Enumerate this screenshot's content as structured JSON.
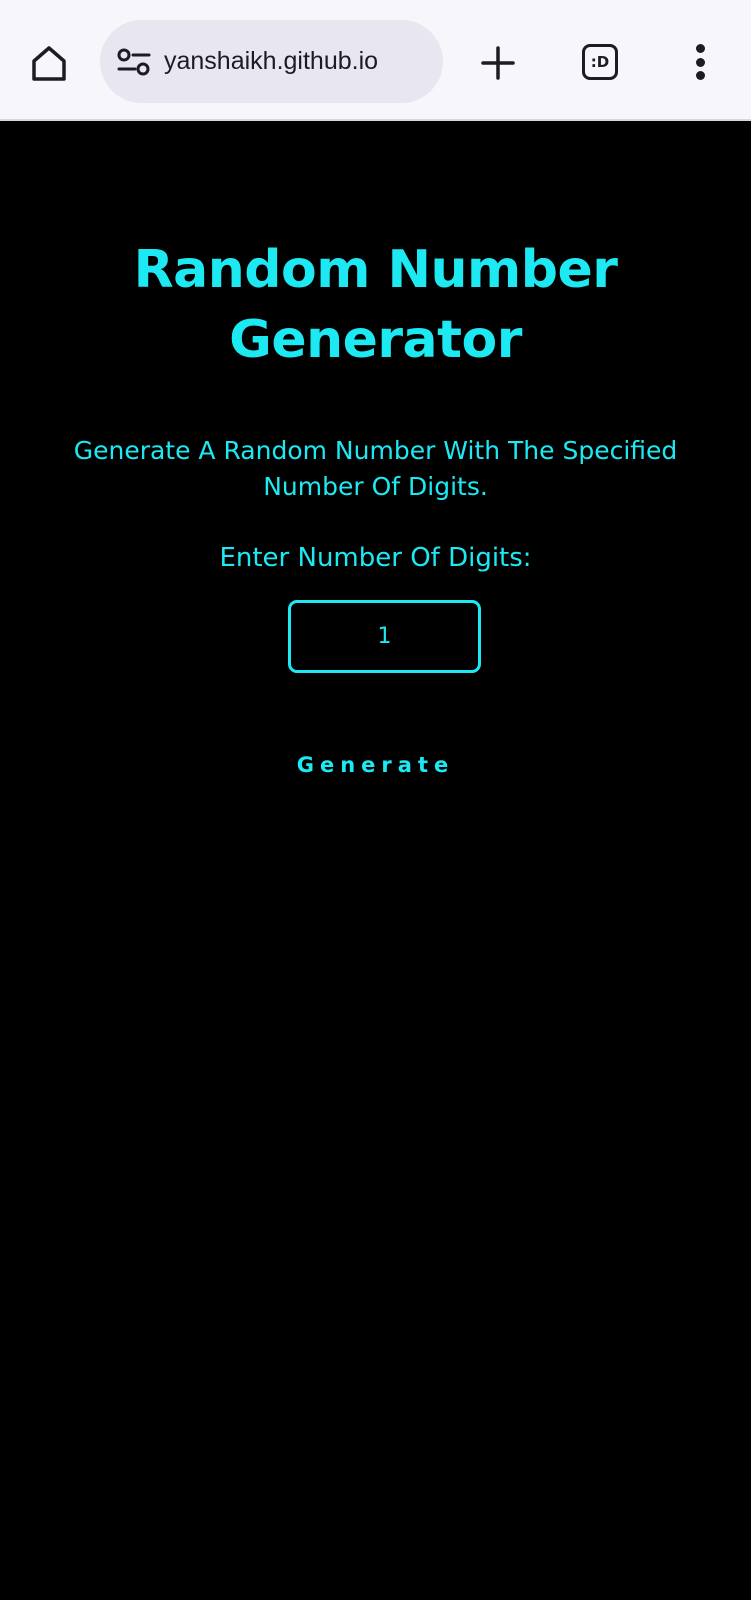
{
  "browser": {
    "url": "yanshaikh.github.io",
    "tabs_label": ":D"
  },
  "page": {
    "title": "Random Number Generator",
    "description": "Generate A Random Number With The Specified Number Of Digits.",
    "digits_label": "Enter Number Of Digits:",
    "digits_value": "1",
    "generate_label": "Generate"
  },
  "colors": {
    "accent": "#1de9f3",
    "background": "#000000",
    "browser_bar": "#f7f6fb",
    "url_pill": "#e7e6f1"
  },
  "icons": {
    "home": "home-icon",
    "site_settings": "site-settings-icon",
    "new_tab": "plus-icon",
    "menu": "more-vert-icon"
  }
}
